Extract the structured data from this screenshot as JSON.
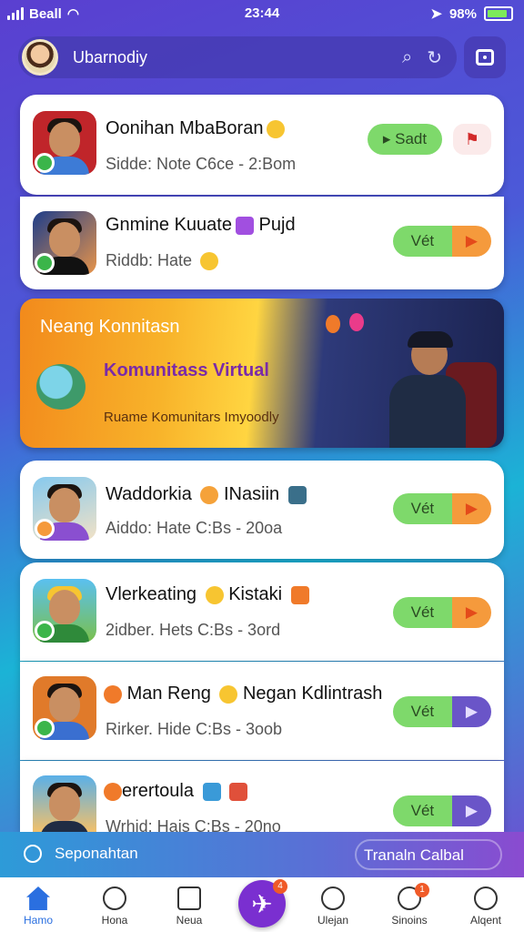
{
  "status_bar": {
    "carrier": "Beall",
    "time": "23:44",
    "battery": "98%"
  },
  "header": {
    "title": "Ubarnodiy",
    "search_icon": "search-icon",
    "refresh_icon": "refresh-icon",
    "camera_icon": "camera-icon"
  },
  "items": [
    {
      "name": "Oonihan MbaBoran",
      "sub": "Sidde: Note   C6ce - 2:Bom",
      "button_left": "Sadt",
      "button_right": "",
      "button_right_icon": "flag-icon"
    },
    {
      "name": "Gnmine Kuuate",
      "name_tail": "Pujd",
      "sub": "Riddb: Hate",
      "button_left": "Vét",
      "button_right": "▶"
    },
    {
      "name": "Waddorkia",
      "name_tail": "INasiin",
      "sub": "Aiddo: Hate   C:Bs - 20oa",
      "button_left": "Vét",
      "button_right": "▶"
    },
    {
      "name": "Vlerkeating",
      "name_tail": "Kistaki",
      "sub": "2idber. Hets   C:Bs - 3ord",
      "button_left": "Vét",
      "button_right": "▶"
    },
    {
      "name": "Man Reng",
      "name_tail": "Negan Kdlintrash",
      "sub": "Rirker. Hide   C:Bs - 3oob",
      "button_left": "Vét",
      "button_right": "▶"
    },
    {
      "name": "erertoula",
      "name_tail": "",
      "sub": "Wrhid: Hais   C:Bs - 20no",
      "button_left": "Vét",
      "button_right": "▶"
    }
  ],
  "banner": {
    "title": "Neang Konnitasn",
    "subtitle": "Komunitass Virtual",
    "footer": "Ruame Komunitars Imyoodly"
  },
  "bottom_strip": {
    "left_label": "Seponahtan",
    "right_label": "Tranaln Calbal"
  },
  "tabs": [
    {
      "label": "Hamo",
      "icon": "home-icon",
      "active": true
    },
    {
      "label": "Hona",
      "icon": "compass-icon"
    },
    {
      "label": "Neua",
      "icon": "grid-icon"
    },
    {
      "label": "Ulejan",
      "icon": "user-icon"
    },
    {
      "label": "Sinoins",
      "icon": "clock-icon",
      "badge": "1"
    },
    {
      "label": "Alqent",
      "icon": "profile-icon"
    }
  ],
  "fab": {
    "icon": "send-icon",
    "badge": "4"
  },
  "colors": {
    "accent": "#7a2fd0",
    "pill_green": "#7ed96b",
    "pill_orange": "#f59a3c",
    "pill_purple": "#6a55c8",
    "active_tab": "#2a6fe0"
  }
}
